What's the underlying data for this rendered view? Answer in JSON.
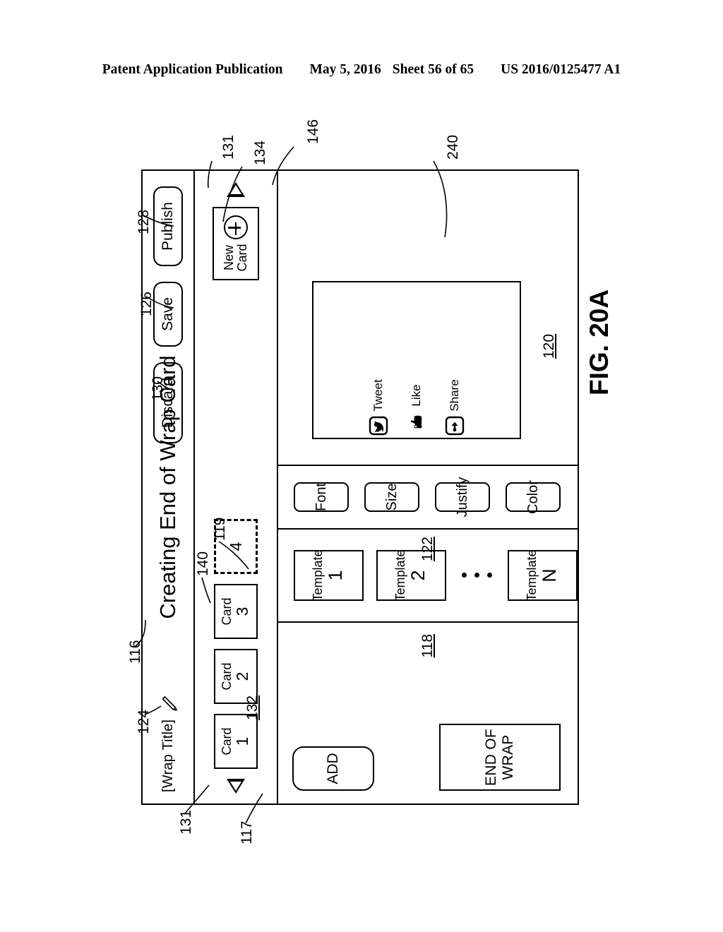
{
  "publication_header": {
    "left": "Patent Application Publication",
    "date": "May 5, 2016",
    "sheet": "Sheet 56 of 65",
    "number": "US 2016/0125477 A1"
  },
  "figure": {
    "label": "FIG. 20A"
  },
  "titlebar": {
    "wrap_title": "[Wrap Title]",
    "pencil_icon": "pencil-icon",
    "figure_title": "Creating End of Wrap Card",
    "buttons": [
      {
        "label": "Discard",
        "ref": "130"
      },
      {
        "label": "Save",
        "ref": "126"
      },
      {
        "label": "Publish",
        "ref": "128"
      }
    ]
  },
  "cardbar": {
    "ref": "132",
    "scroll_left_icon": "triangle-left-icon",
    "scroll_right_icon": "triangle-right-icon",
    "cards": [
      {
        "line1": "Card",
        "line2": "1",
        "dashed": false
      },
      {
        "line1": "Card",
        "line2": "2",
        "dashed": false
      },
      {
        "line1": "Card",
        "line2": "3",
        "dashed": false
      },
      {
        "line1": "",
        "line2": "4",
        "dashed": true
      }
    ],
    "new_card": {
      "line1": "New",
      "line2": "Card",
      "plus_icon": "plus-circle-icon",
      "ref": "134"
    }
  },
  "panel_118": {
    "ref": "118",
    "end_of_wrap_label": "END OF WRAP",
    "end_of_wrap_ref": "117",
    "add_label": "ADD",
    "add_ref": "119"
  },
  "panel_122": {
    "ref": "122",
    "templates": [
      {
        "line1": "Template",
        "line2": "1"
      },
      {
        "line1": "Template",
        "line2": "2"
      },
      {
        "line1": "Template",
        "line2": "N"
      }
    ],
    "ellipsis": "• • •"
  },
  "format_toolbar": {
    "ref": "146",
    "buttons": [
      {
        "label": "Font"
      },
      {
        "label": "Size"
      },
      {
        "label": "Justify"
      },
      {
        "label": "Color"
      }
    ]
  },
  "preview": {
    "ref": "120",
    "card_ref": "240",
    "social": [
      {
        "label": "Share",
        "icon": "share-icon"
      },
      {
        "label": "Like",
        "icon": "thumbs-up-icon"
      },
      {
        "label": "Tweet",
        "icon": "twitter-bird-icon"
      }
    ]
  },
  "callouts": {
    "c116": "116",
    "c124": "124",
    "c130": "130",
    "c126": "126",
    "c128": "128",
    "c131a": "131",
    "c131b": "131",
    "c134": "134",
    "c146": "146",
    "c140": "140",
    "c119": "119",
    "c117": "117",
    "c240": "240"
  }
}
